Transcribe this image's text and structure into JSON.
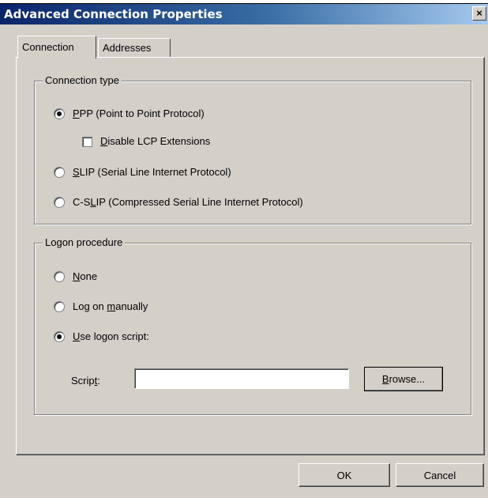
{
  "window": {
    "title": "Advanced Connection Properties",
    "close_label": "×"
  },
  "tabs": [
    {
      "label": "Connection",
      "active": true
    },
    {
      "label": "Addresses",
      "active": false
    }
  ],
  "connection_type": {
    "title": "Connection type",
    "ppp": {
      "label_pre": "",
      "accel": "P",
      "label_post": "PP (Point to Point Protocol)",
      "checked": true
    },
    "disable_lcp": {
      "label_pre": "",
      "accel": "D",
      "label_post": "isable LCP Extensions",
      "checked": false
    },
    "slip": {
      "label_pre": "",
      "accel": "S",
      "label_post": "LIP (Serial Line Internet Protocol)",
      "checked": false
    },
    "cslip": {
      "label_pre": "C-S",
      "accel": "L",
      "label_post": "IP (Compressed Serial Line Internet Protocol)",
      "checked": false
    }
  },
  "logon_procedure": {
    "title": "Logon procedure",
    "none": {
      "label_pre": "",
      "accel": "N",
      "label_post": "one",
      "checked": false
    },
    "manual": {
      "label_pre": "Log on ",
      "accel": "m",
      "label_post": "anually",
      "checked": false
    },
    "script": {
      "label_pre": "",
      "accel": "U",
      "label_post": "se logon script:",
      "checked": true
    },
    "script_field": {
      "label_pre": "Scrip",
      "accel": "t",
      "label_post": ":",
      "value": ""
    },
    "browse": {
      "label_pre": "",
      "accel": "B",
      "label_post": "rowse..."
    }
  },
  "footer": {
    "ok_label": "OK",
    "cancel_label": "Cancel"
  }
}
